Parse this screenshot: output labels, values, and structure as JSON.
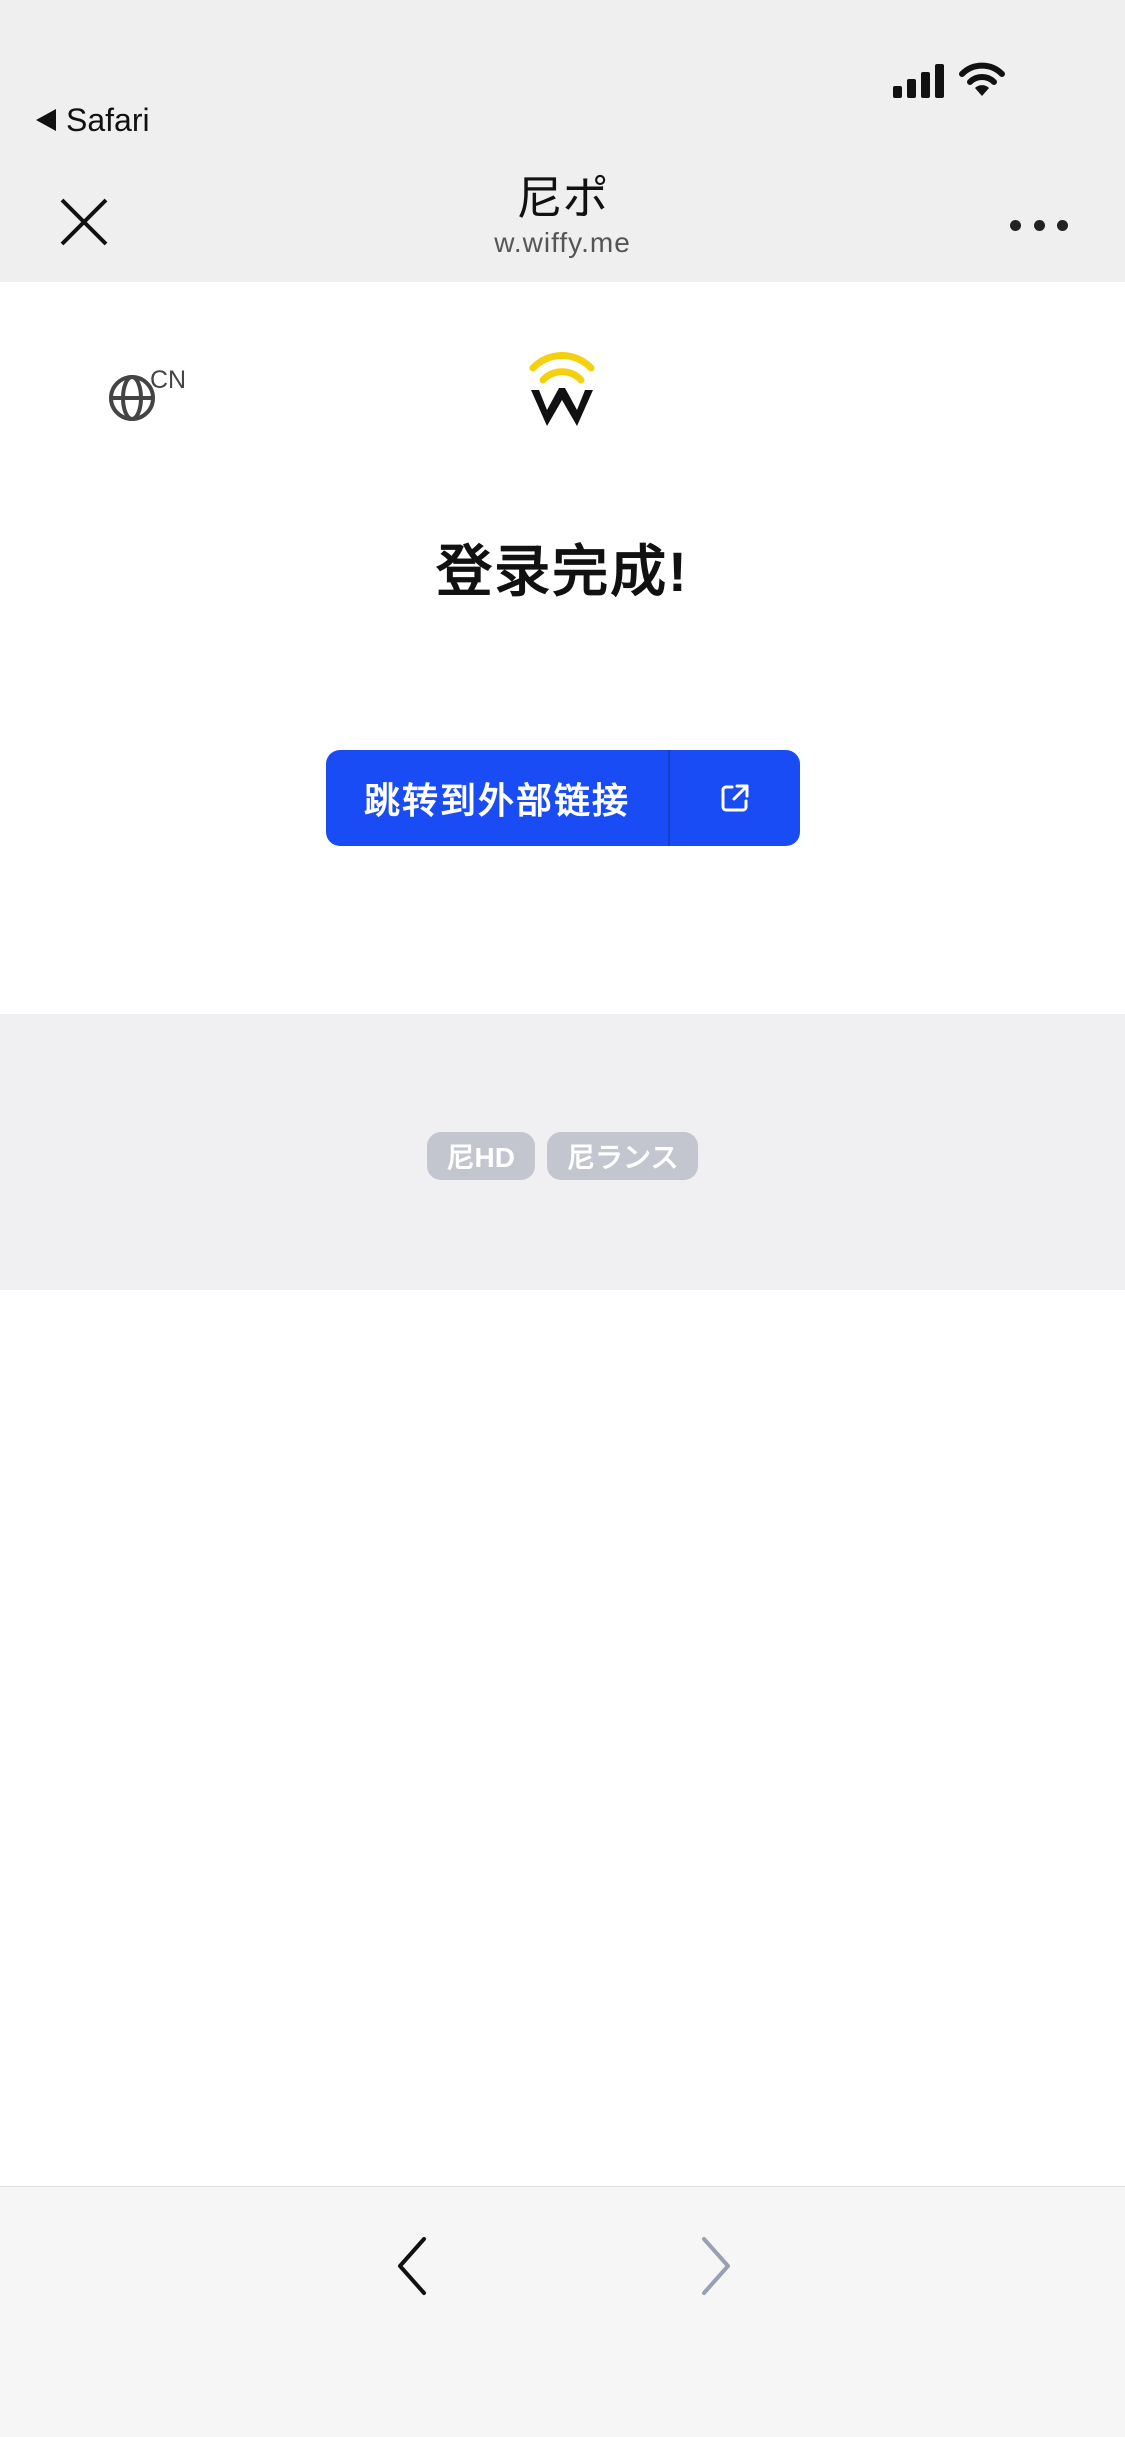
{
  "status_bar": {
    "back_app": "Safari",
    "icons": [
      "signal-icon",
      "wifi-icon"
    ]
  },
  "nav": {
    "title": "尼ポ",
    "subtitle": "w.wiffy.me",
    "icons": [
      "close-icon",
      "more-icon"
    ]
  },
  "content": {
    "language_code": "CN",
    "language_icon": "globe-icon",
    "logo_icon": "wiffy-logo-icon",
    "heading": "登录完成!",
    "external_button": {
      "label": "跳转到外部链接",
      "icon": "external-link-icon",
      "color": "#1a4cf6"
    }
  },
  "tags": [
    {
      "label": "尼HD"
    },
    {
      "label": "尼ランス"
    }
  ],
  "toolbar": {
    "icons": [
      "back-chevron-icon",
      "forward-chevron-icon"
    ]
  },
  "colors": {
    "accent": "#1a4cf6",
    "logo_yellow": "#f5d00f",
    "bar_bg": "#efefef",
    "tag_bg": "#c3c6cf"
  }
}
